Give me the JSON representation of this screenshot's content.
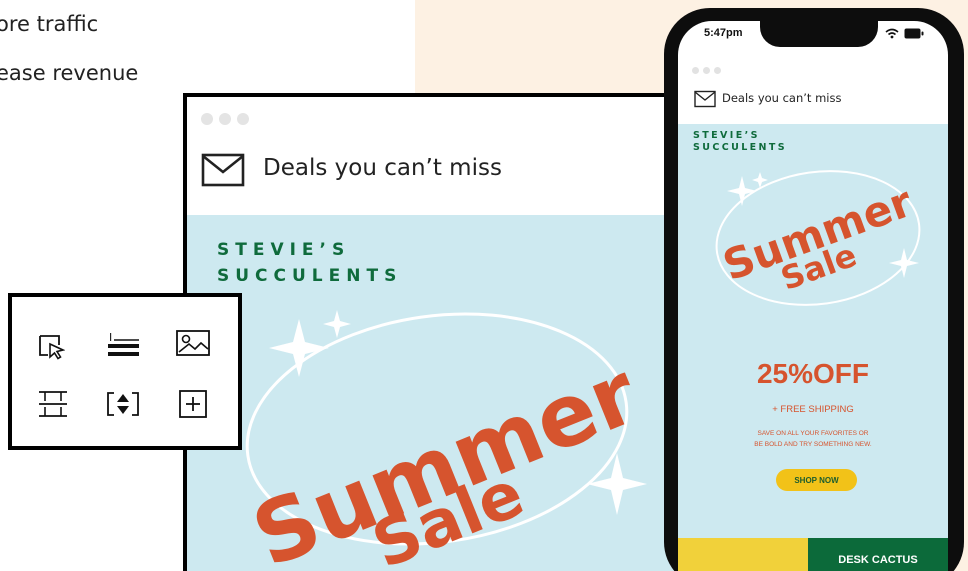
{
  "intro": {
    "bullet_1": "ore traffic",
    "bullet_2": "ease revenue"
  },
  "desktop_email": {
    "subject": "Deals you can’t miss",
    "brand_line_1": "STEVIE’S",
    "brand_line_2": "SUCCULENTS",
    "headline_word_1": "Summer",
    "headline_word_2": "Sale"
  },
  "toolbar": {
    "tools": [
      "select-tool-icon",
      "text-tool-icon",
      "image-tool-icon",
      "divider-tool-icon",
      "spacer-tool-icon",
      "add-block-icon"
    ]
  },
  "phone_email": {
    "time": "5:47pm",
    "subject": "Deals you can’t miss",
    "brand_line_1": "STEVIE’S",
    "brand_line_2": "SUCCULENTS",
    "headline_word_1": "Summer",
    "headline_word_2": "Sale",
    "discount": "25%OFF",
    "free_shipping": "+ FREE SHIPPING",
    "save_line_1": "SAVE ON ALL YOUR FAVORITES OR",
    "save_line_2": "BE BOLD AND TRY SOMETHING NEW.",
    "shop_button": "SHOP NOW",
    "product_tile": "DESK CACTUS"
  },
  "colors": {
    "brand_green": "#0f6b3c",
    "sale_orange": "#d6542e",
    "email_bg": "#cde9f0",
    "button_yellow": "#f2c218",
    "peach_bg": "#fdf1e3"
  }
}
